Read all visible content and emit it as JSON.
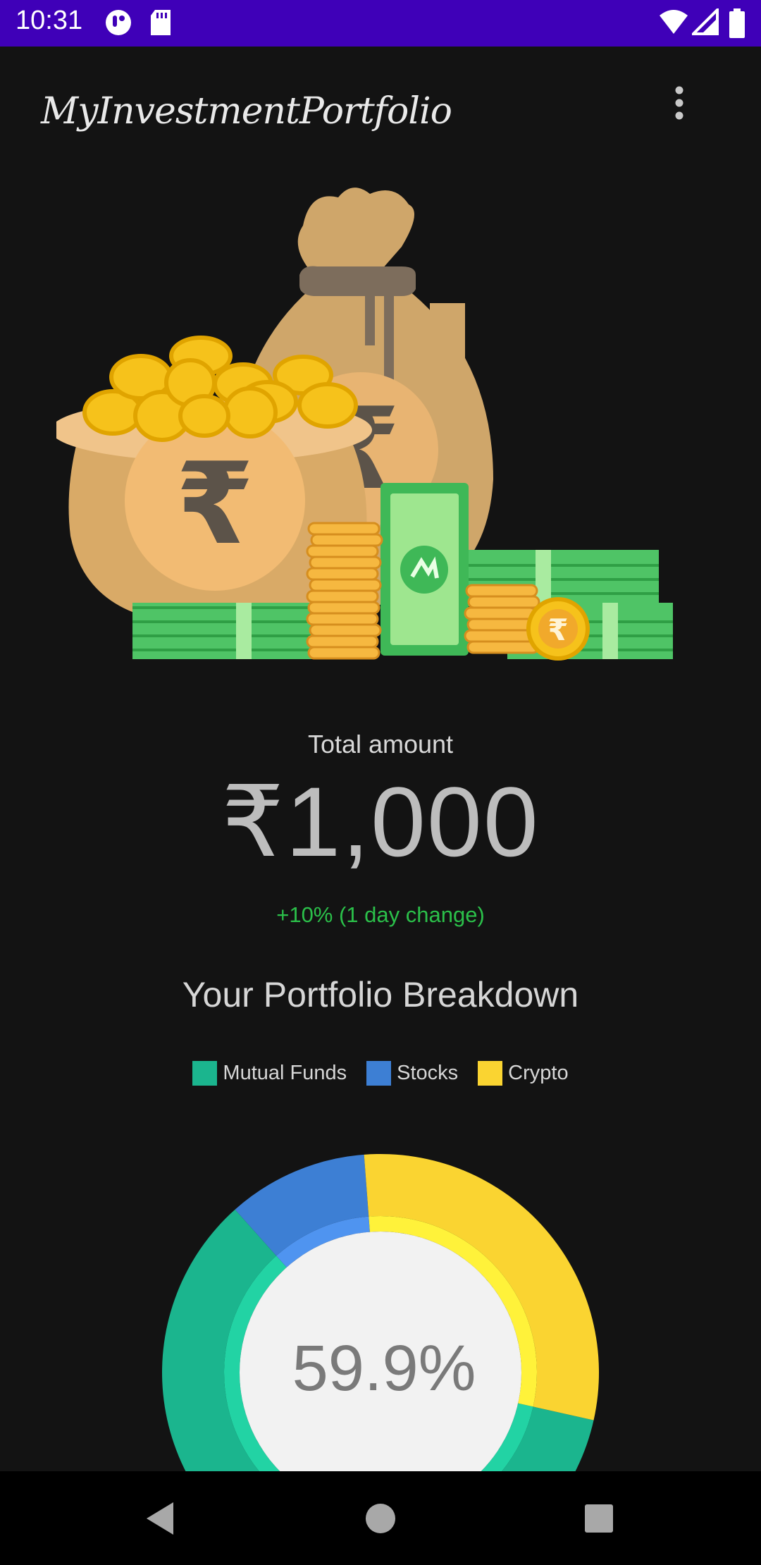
{
  "status_bar": {
    "time": "10:31",
    "icons": [
      "notification-app-icon",
      "sd-card-icon",
      "wifi-icon",
      "signal-icon",
      "battery-icon"
    ],
    "background": "#3f00b8"
  },
  "app_bar": {
    "title": "MyInvestmentPortfolio",
    "menu_icon": "more-vertical-icon"
  },
  "hero": {
    "icon": "money-bags-coins-banknotes-illustration"
  },
  "summary": {
    "total_label": "Total amount",
    "total_amount": "₹1,000",
    "day_change": "+10% (1 day change)",
    "day_change_color": "#2bc04a"
  },
  "breakdown": {
    "title": "Your Portfolio Breakdown",
    "legend": [
      {
        "label": "Mutual Funds",
        "color": "#1bb58e"
      },
      {
        "label": "Stocks",
        "color": "#3d7fd4"
      },
      {
        "label": "Crypto",
        "color": "#fad431"
      }
    ]
  },
  "chart_data": {
    "type": "pie",
    "style": "donut",
    "categories": [
      "Mutual Funds",
      "Stocks",
      "Crypto"
    ],
    "values": [
      59.9,
      10.4,
      29.7
    ],
    "colors": [
      "#1bb58e",
      "#3d7fd4",
      "#fad431"
    ],
    "center_label": "59.9%",
    "highlighted": "Mutual Funds"
  },
  "nav_bar": {
    "back": "back-triangle-icon",
    "home": "home-circle-icon",
    "recents": "recents-square-icon"
  }
}
